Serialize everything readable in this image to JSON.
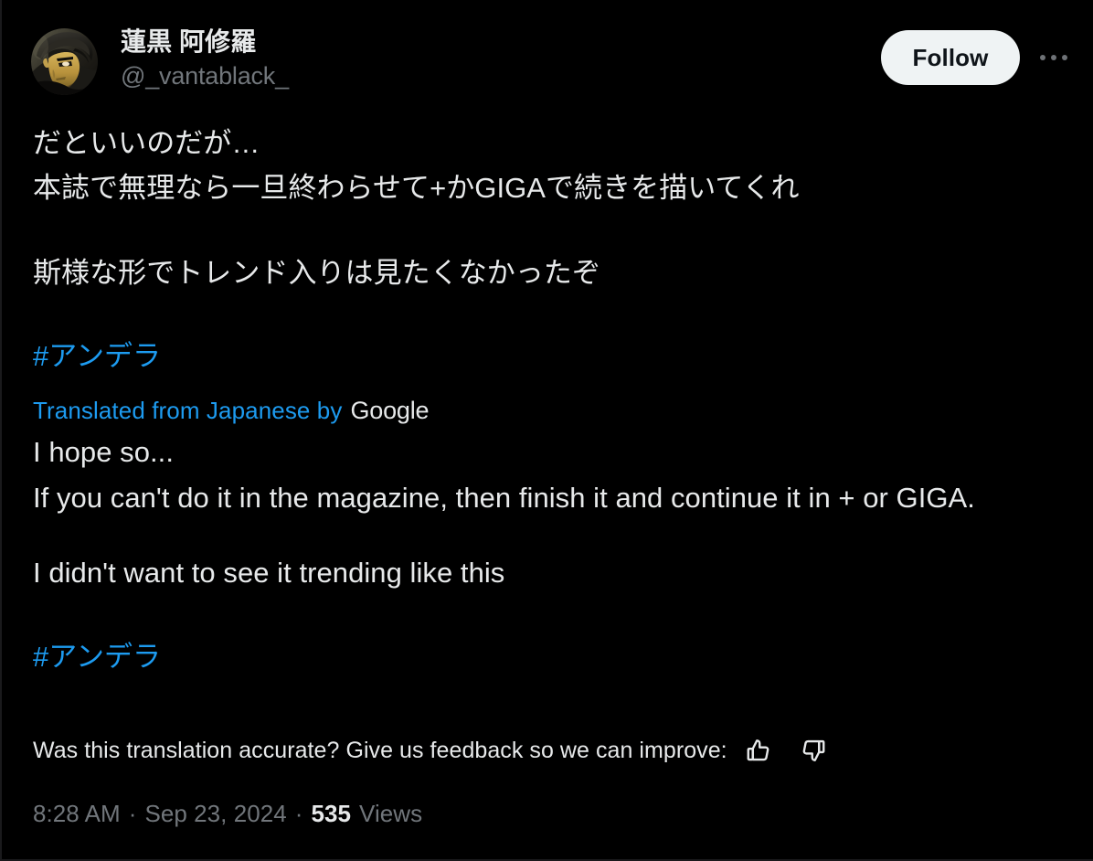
{
  "post": {
    "author": {
      "display_name": "蓮黒 阿修羅",
      "handle": "@_vantablack_",
      "avatar_alt": "berserk-character-avatar"
    },
    "actions": {
      "follow_label": "Follow",
      "more_label": "more-options"
    },
    "original_text": {
      "line1": "だといいのだが…",
      "line2": "本誌で無理なら一旦終わらせて+かGIGAで続きを描いてくれ",
      "line3": "斯様な形でトレンド入りは見たくなかったぞ",
      "hashtag": "#アンデラ"
    },
    "translation": {
      "attribution_label": "Translated from Japanese by",
      "attribution_brand": "Google",
      "paragraph1": "I hope so...\nIf you can't do it in the magazine, then finish it and continue it in + or GIGA.",
      "paragraph2": "I didn't want to see it trending like this",
      "hashtag": "#アンデラ"
    },
    "feedback": {
      "prompt": "Was this translation accurate? Give us feedback so we can improve:",
      "thumbs_up_icon": "thumbs-up-icon",
      "thumbs_down_icon": "thumbs-down-icon"
    },
    "meta": {
      "time": "8:28 AM",
      "separator": "·",
      "date": "Sep 23, 2024",
      "views_count": "535",
      "views_label": "Views"
    }
  },
  "colors": {
    "background": "#000000",
    "text_primary": "#e7e9ea",
    "text_secondary": "#71767b",
    "link_blue": "#1d9bf0",
    "follow_button_bg": "#eff3f4",
    "follow_button_text": "#0f1419"
  }
}
